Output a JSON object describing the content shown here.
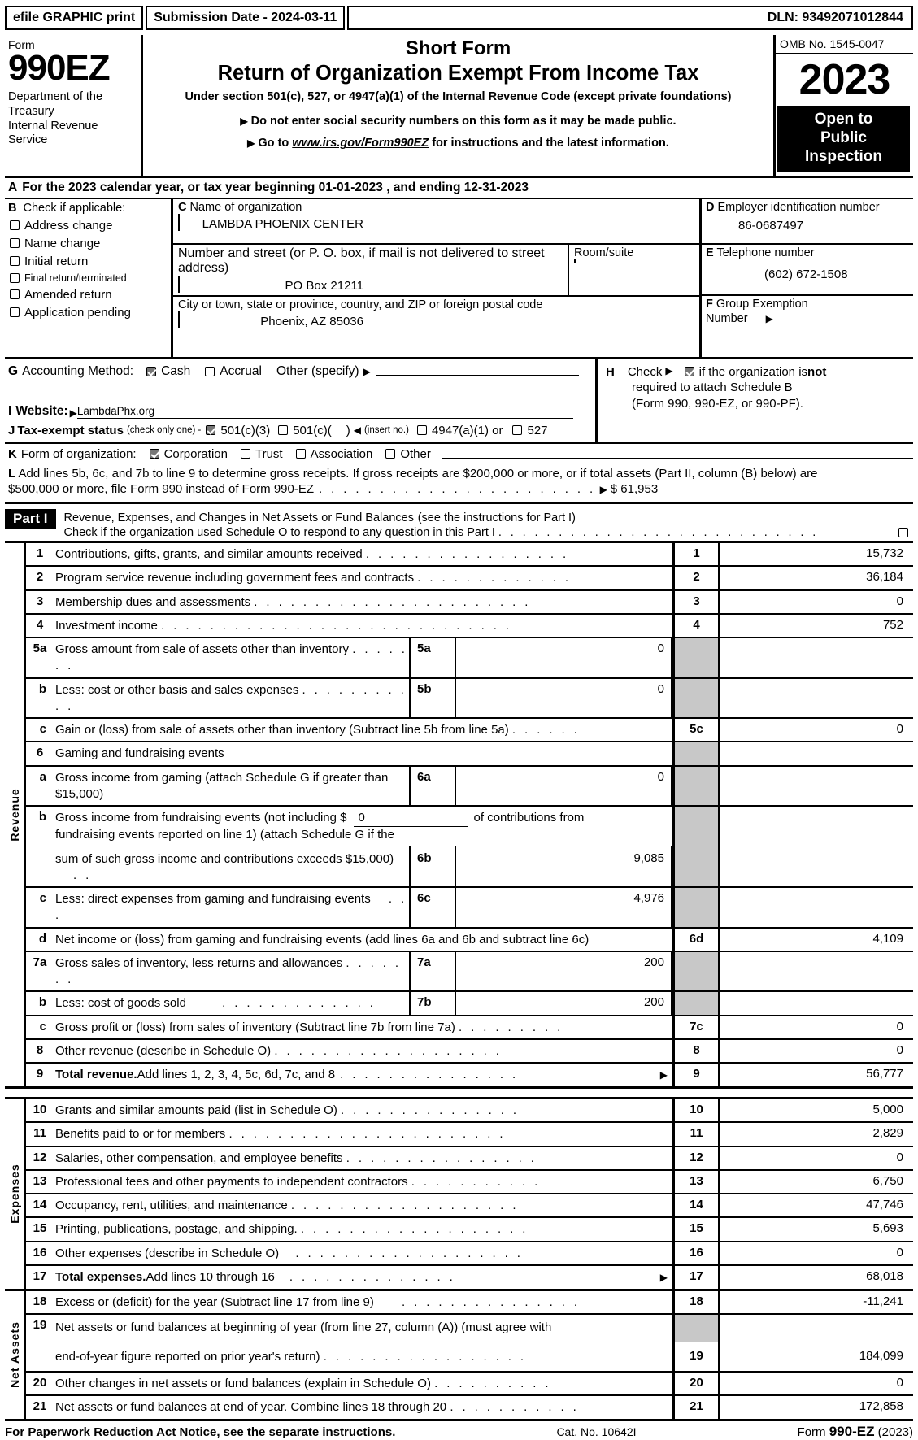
{
  "efile": {
    "left": "efile GRAPHIC print",
    "submission": "Submission Date - 2024-03-11",
    "dln": "DLN: 93492071012844"
  },
  "masthead": {
    "form_label": "Form",
    "form_number": "990EZ",
    "department": "Department of the Treasury Internal Revenue Service",
    "title1": "Short Form",
    "title2": "Return of Organization Exempt From Income Tax",
    "subtitle": "Under section 501(c), 527, or 4947(a)(1) of the Internal Revenue Code (except private foundations)",
    "note1": "Do not enter social security numbers on this form as it may be made public.",
    "note2_pre": "Go to ",
    "note2_url": "www.irs.gov/Form990EZ",
    "note2_post": " for instructions and the latest information.",
    "omb": "OMB No. 1545-0047",
    "year": "2023",
    "open_line1": "Open to",
    "open_line2": "Public",
    "open_line3": "Inspection"
  },
  "lineA": {
    "letter": "A",
    "text": "For the 2023 calendar year, or tax year beginning 01-01-2023 , and ending 12-31-2023"
  },
  "sectionB": {
    "letter": "B",
    "heading": "Check if applicable:",
    "options": [
      {
        "label": "Address change",
        "checked": false
      },
      {
        "label": "Name change",
        "checked": false
      },
      {
        "label": "Initial return",
        "checked": false
      },
      {
        "label": "Final return/terminated",
        "checked": false
      },
      {
        "label": "Amended return",
        "checked": false
      },
      {
        "label": "Application pending",
        "checked": false
      }
    ]
  },
  "sectionC": {
    "letter": "C",
    "name_label": "Name of organization",
    "name_value": "LAMBDA PHOENIX CENTER",
    "street_label": "Number and street (or P. O. box, if mail is not delivered to street address)",
    "street_value": "PO Box 21211",
    "room_label": "Room/suite",
    "room_value": "",
    "city_label": "City or town, state or province, country, and ZIP or foreign postal code",
    "city_value": "Phoenix, AZ  85036"
  },
  "sectionD": {
    "ein_letter": "D",
    "ein_label": "Employer identification number",
    "ein_value": "86-0687497",
    "tel_letter": "E",
    "tel_label": "Telephone number",
    "tel_value": "(602) 672-1508",
    "grp_letter": "F",
    "grp_label1": "Group Exemption",
    "grp_label2": "Number",
    "grp_value": ""
  },
  "sectionG": {
    "letter": "G",
    "label": "Accounting Method:",
    "cash": "Cash",
    "cash_checked": true,
    "accrual": "Accrual",
    "accrual_checked": false,
    "other": "Other (specify)",
    "other_value": ""
  },
  "sectionH": {
    "letter": "H",
    "check_word": "Check",
    "checked": true,
    "line1a": "if the organization is ",
    "line1b": "not",
    "line2": "required to attach Schedule B",
    "line3": "(Form 990, 990-EZ, or 990-PF)."
  },
  "sectionI": {
    "letter": "I",
    "label": "Website:",
    "value": "LambdaPhx.org"
  },
  "sectionJ": {
    "letter": "J",
    "label": "Tax-exempt status",
    "note": "(check only one) -",
    "opt1": "501(c)(3)",
    "opt1_checked": true,
    "opt2": "501(c)(",
    "opt2_checked": false,
    "opt2_tail": ")",
    "insert": "(insert no.)",
    "opt3": "4947(a)(1) or",
    "opt3_checked": false,
    "opt4": "527",
    "opt4_checked": false
  },
  "sectionK": {
    "letter": "K",
    "label": "Form of organization:",
    "options": [
      {
        "label": "Corporation",
        "checked": true
      },
      {
        "label": "Trust",
        "checked": false
      },
      {
        "label": "Association",
        "checked": false
      },
      {
        "label": "Other",
        "checked": false
      }
    ]
  },
  "sectionL": {
    "letter": "L",
    "line1": "Add lines 5b, 6c, and 7b to line 9 to determine gross receipts. If gross receipts are $200,000 or more, or if total assets (Part II, column (B) below) are",
    "line2": "$500,000 or more, file Form 990 instead of Form 990-EZ",
    "amount": "$ 61,953"
  },
  "partI": {
    "tag": "Part I",
    "title": "Revenue, Expenses, and Changes in Net Assets or Fund Balances",
    "title_note": "(see the instructions for Part I)",
    "subline": "Check if the organization used Schedule O to respond to any question in this Part I",
    "subline_checked": false
  },
  "vertical_labels": {
    "revenue": "Revenue",
    "expenses": "Expenses",
    "net_assets": "Net Assets"
  },
  "revenue_rows": [
    {
      "num": "1",
      "desc": "Contributions, gifts, grants, and similar amounts received",
      "code": "1",
      "value": "15,732"
    },
    {
      "num": "2",
      "desc": "Program service revenue including government fees and contracts",
      "code": "2",
      "value": "36,184"
    },
    {
      "num": "3",
      "desc": "Membership dues and assessments",
      "code": "3",
      "value": "0"
    },
    {
      "num": "4",
      "desc": "Investment income",
      "code": "4",
      "value": "752"
    },
    {
      "num": "5a",
      "desc": "Gross amount from sale of assets other than inventory",
      "mid_code": "5a",
      "mid_value": "0"
    },
    {
      "num": "b",
      "desc": "Less: cost or other basis and sales expenses",
      "mid_code": "5b",
      "mid_value": "0"
    },
    {
      "num": "c",
      "desc": "Gain or (loss) from sale of assets other than inventory (Subtract line 5b from line 5a)",
      "code": "5c",
      "value": "0"
    },
    {
      "num": "6",
      "desc": "Gaming and fundraising events"
    },
    {
      "num": "a",
      "desc": "Gross income from gaming (attach Schedule G if greater than $15,000)",
      "mid_code": "6a",
      "mid_value": "0"
    },
    {
      "num": "b",
      "desc": "Gross income from fundraising events (not including $ ___0___ of contributions from",
      "mid_code": "6b",
      "mid_value": "9,085"
    },
    {
      "num": "c",
      "desc": "Less: direct expenses from gaming and fundraising events",
      "mid_code": "6c",
      "mid_value": "4,976"
    },
    {
      "num": "d",
      "desc": "Net income or (loss) from gaming and fundraising events (add lines 6a and 6b and subtract line 6c)",
      "code": "6d",
      "value": "4,109"
    },
    {
      "num": "7a",
      "desc": "Gross sales of inventory, less returns and allowances",
      "mid_code": "7a",
      "mid_value": "200"
    },
    {
      "num": "b",
      "desc": "Less: cost of goods sold",
      "mid_code": "7b",
      "mid_value": "200"
    },
    {
      "num": "c",
      "desc": "Gross profit or (loss) from sales of inventory (Subtract line 7b from line 7a)",
      "code": "7c",
      "value": "0"
    },
    {
      "num": "8",
      "desc": "Other revenue (describe in Schedule O)",
      "code": "8",
      "value": "0"
    },
    {
      "num": "9",
      "desc_bold": "Total revenue.",
      "desc": " Add lines 1, 2, 3, 4, 5c, 6d, 7c, and 8",
      "code": "9",
      "value": "56,777"
    }
  ],
  "line6b": {
    "part1": "Gross income from fundraising events (not including $",
    "inline_value": "0",
    "part2": "of contributions from",
    "part3": "fundraising events reported on line 1) (attach Schedule G if the",
    "part4": "sum of such gross income and contributions exceeds $15,000)"
  },
  "expense_rows": [
    {
      "num": "10",
      "desc": "Grants and similar amounts paid (list in Schedule O)",
      "code": "10",
      "value": "5,000"
    },
    {
      "num": "11",
      "desc": "Benefits paid to or for members",
      "code": "11",
      "value": "2,829"
    },
    {
      "num": "12",
      "desc": "Salaries, other compensation, and employee benefits",
      "code": "12",
      "value": "0"
    },
    {
      "num": "13",
      "desc": "Professional fees and other payments to independent contractors",
      "code": "13",
      "value": "6,750"
    },
    {
      "num": "14",
      "desc": "Occupancy, rent, utilities, and maintenance",
      "code": "14",
      "value": "47,746"
    },
    {
      "num": "15",
      "desc": "Printing, publications, postage, and shipping.",
      "code": "15",
      "value": "5,693"
    },
    {
      "num": "16",
      "desc": "Other expenses (describe in Schedule O)",
      "code": "16",
      "value": "0"
    },
    {
      "num": "17",
      "desc_bold": "Total expenses.",
      "desc": " Add lines 10 through 16",
      "code": "17",
      "value": "68,018"
    }
  ],
  "netasset_rows": [
    {
      "num": "18",
      "desc": "Excess or (deficit) for the year (Subtract line 17 from line 9)",
      "code": "18",
      "value": "-11,241"
    },
    {
      "num": "19",
      "desc_l1": "Net assets or fund balances at beginning of year (from line 27, column (A)) (must agree with",
      "desc_l2": "end-of-year figure reported on prior year's return)",
      "code": "19",
      "value": "184,099"
    },
    {
      "num": "20",
      "desc": "Other changes in net assets or fund balances (explain in Schedule O)",
      "code": "20",
      "value": "0"
    },
    {
      "num": "21",
      "desc": "Net assets or fund balances at end of year. Combine lines 18 through 20",
      "code": "21",
      "value": "172,858"
    }
  ],
  "footer": {
    "notice": "For Paperwork Reduction Act Notice, see the separate instructions.",
    "cat": "Cat. No. 10642I",
    "form_pre": "Form ",
    "form_bold": "990-EZ",
    "form_year": " (2023)"
  }
}
